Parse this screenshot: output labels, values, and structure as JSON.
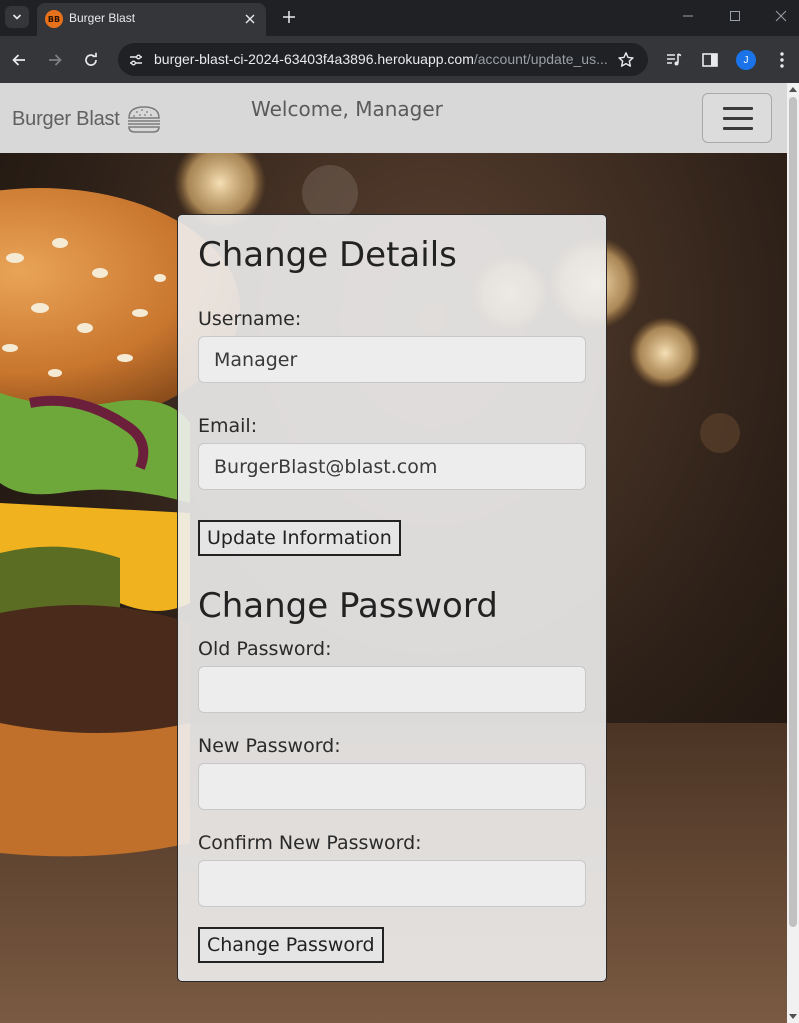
{
  "browser": {
    "tab_title": "Burger Blast",
    "favicon_text": "BB",
    "url_host": "burger-blast-ci-2024-63403f4a3896.herokuapp.com",
    "url_path": "/account/update_us...",
    "profile_initial": "J"
  },
  "navbar": {
    "brand": "Burger Blast",
    "welcome": "Welcome, Manager"
  },
  "details": {
    "heading": "Change Details",
    "username_label": "Username:",
    "username_value": "Manager",
    "email_label": "Email:",
    "email_value": "BurgerBlast@blast.com",
    "update_button": "Update Information"
  },
  "password": {
    "heading": "Change Password",
    "old_label": "Old Password:",
    "new_label": "New Password:",
    "confirm_label": "Confirm New Password:",
    "change_button": "Change Password"
  },
  "colors": {
    "chrome_dark": "#202124",
    "chrome_toolbar": "#35363a",
    "navbar_bg": "#d8d8d8",
    "card_bg": "#eeeeee"
  }
}
